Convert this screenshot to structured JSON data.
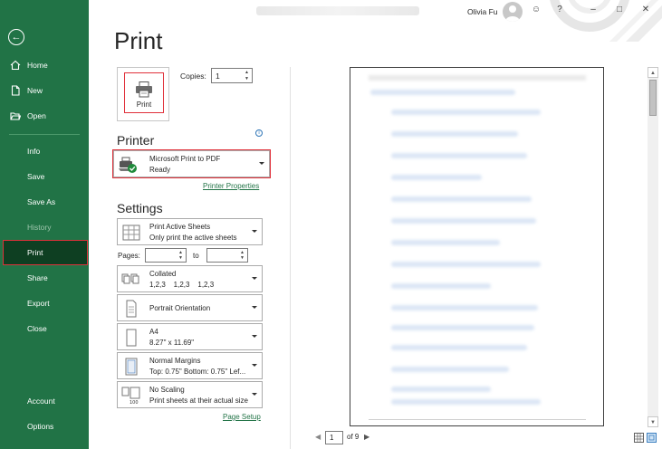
{
  "window": {
    "user_name": "Olivia Fu"
  },
  "sidebar": {
    "items": [
      {
        "label": "Home",
        "icon": "home-icon"
      },
      {
        "label": "New",
        "icon": "new-document-icon"
      },
      {
        "label": "Open",
        "icon": "folder-open-icon"
      },
      {
        "label": "Info"
      },
      {
        "label": "Save"
      },
      {
        "label": "Save As"
      },
      {
        "label": "History",
        "state": "disabled"
      },
      {
        "label": "Print",
        "state": "selected"
      },
      {
        "label": "Share"
      },
      {
        "label": "Export"
      },
      {
        "label": "Close"
      },
      {
        "label": "Account"
      },
      {
        "label": "Options"
      }
    ]
  },
  "main": {
    "title": "Print",
    "print_button_label": "Print",
    "copies_label": "Copies:",
    "copies_value": "1",
    "printer_section": "Printer",
    "printer": {
      "name": "Microsoft Print to PDF",
      "status": "Ready"
    },
    "printer_properties_link": "Printer Properties",
    "settings_section": "Settings",
    "settings": [
      {
        "line1": "Print Active Sheets",
        "line2": "Only print the active sheets"
      },
      {
        "line1": "Collated",
        "line2": "1,2,3    1,2,3    1,2,3"
      },
      {
        "line1": "Portrait Orientation",
        "line2": ""
      },
      {
        "line1": "A4",
        "line2": "8.27\" x 11.69\""
      },
      {
        "line1": "Normal Margins",
        "line2": "Top: 0.75\" Bottom: 0.75\" Lef..."
      },
      {
        "line1": "No Scaling",
        "line2": "Print sheets at their actual size"
      }
    ],
    "pages_label": "Pages:",
    "to_label": "to",
    "page_setup_link": "Page Setup"
  },
  "preview": {
    "current_page": "1",
    "total_pages_text": "of 9"
  },
  "colors": {
    "accent": "#217346",
    "selected_nav": "#0e3f22",
    "highlight": "#e0303a"
  }
}
